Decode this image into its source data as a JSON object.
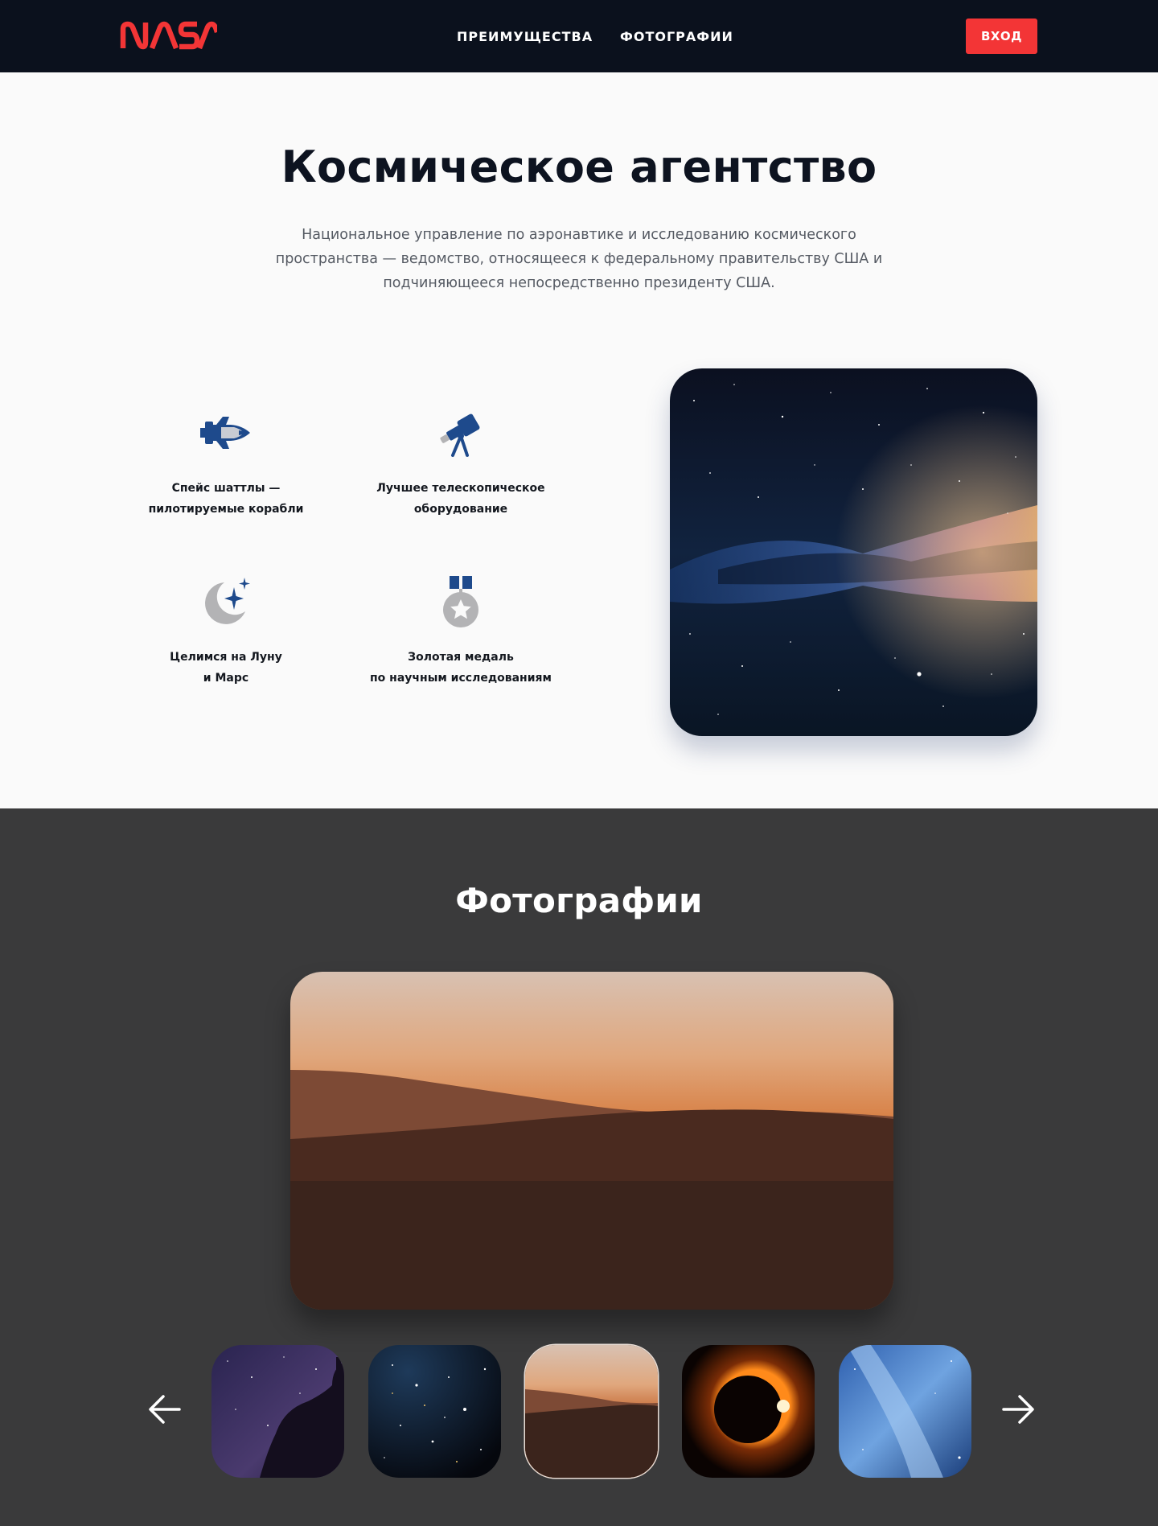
{
  "brand": {
    "logo_text": "NASA",
    "accent": "#f33536",
    "dark": "#0b111d",
    "icon_blue": "#1e4a8c",
    "icon_grey": "#b3b3b5"
  },
  "nav": {
    "items": [
      {
        "label": "ПРЕИМУЩЕСТВА"
      },
      {
        "label": "ФОТОГРАФИИ"
      }
    ],
    "login_label": "ВХОД"
  },
  "hero": {
    "title": "Космическое агентство",
    "description": "Национальное управление по аэронавтике и исследованию космического пространства — ведомство, относящееся к федеральному правительству США и подчиняющееся непосредственно президенту США."
  },
  "features": [
    {
      "icon": "space-shuttle-icon",
      "line1": "Спейс шаттлы —",
      "line2": "пилотируемые корабли"
    },
    {
      "icon": "telescope-icon",
      "line1": "Лучшее телескопическое",
      "line2": "оборудование"
    },
    {
      "icon": "moon-stars-icon",
      "line1": "Целимся на Луну",
      "line2": "и Марс"
    },
    {
      "icon": "medal-icon",
      "line1": "Золотая медаль",
      "line2": "по научным исследованиям"
    }
  ],
  "gallery": {
    "title": "Фотографии",
    "thumbnails": [
      {
        "icon": "stargazer-photo",
        "selected": false
      },
      {
        "icon": "star-field-photo",
        "selected": false
      },
      {
        "icon": "desert-sunset-photo",
        "selected": true
      },
      {
        "icon": "solar-eclipse-photo",
        "selected": false
      },
      {
        "icon": "milky-way-blue-photo",
        "selected": false
      }
    ],
    "bg": "#3a3a3b"
  }
}
